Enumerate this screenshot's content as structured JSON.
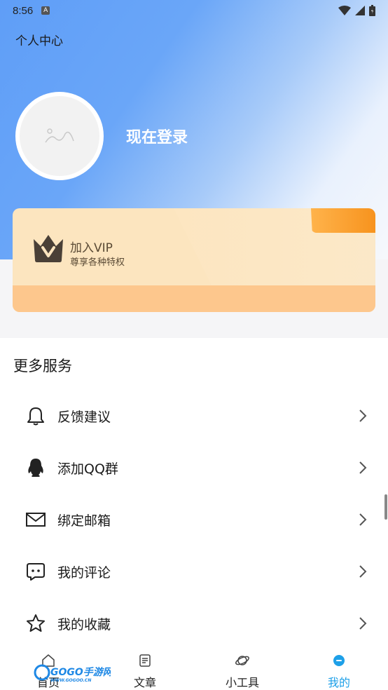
{
  "status_bar": {
    "time": "8:56",
    "notification_icon": "A"
  },
  "header": {
    "title": "个人中心"
  },
  "profile": {
    "login_text": "现在登录"
  },
  "vip": {
    "title": "加入VIP",
    "subtitle": "尊享各种特权"
  },
  "services": {
    "title": "更多服务",
    "items": [
      {
        "label": "反馈建议",
        "icon": "bell-icon"
      },
      {
        "label": "添加QQ群",
        "icon": "qq-icon"
      },
      {
        "label": "绑定邮箱",
        "icon": "mail-icon"
      },
      {
        "label": "我的评论",
        "icon": "comment-icon"
      },
      {
        "label": "我的收藏",
        "icon": "star-icon"
      }
    ]
  },
  "tabbar": {
    "tabs": [
      {
        "label": "首页",
        "icon": "home-icon"
      },
      {
        "label": "文章",
        "icon": "article-icon"
      },
      {
        "label": "小工具",
        "icon": "planet-icon"
      },
      {
        "label": "我的",
        "icon": "profile-icon",
        "active": true
      }
    ]
  },
  "watermark": {
    "text": "GOGO手游网",
    "sub": "WWW.GOGOO.CN"
  },
  "colors": {
    "accent": "#1ea0e8",
    "hero_blue": "#5f9ef7",
    "vip_gold": "#fce5bf"
  }
}
